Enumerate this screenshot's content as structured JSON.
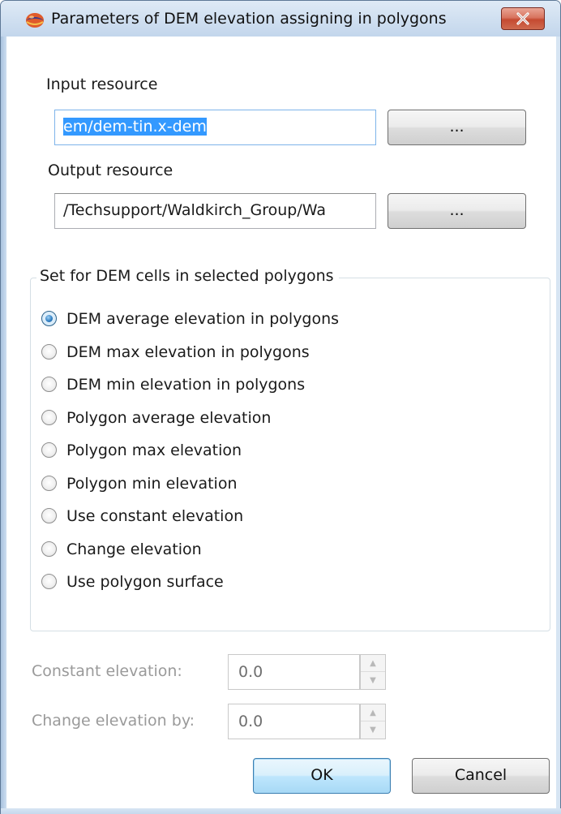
{
  "window": {
    "title": "Parameters of DEM elevation assigning in polygons",
    "icons": {
      "app": "app-globe-icon",
      "close": "close-icon"
    }
  },
  "input_resource": {
    "label": "Input resource",
    "value": "em/dem-tin.x-dem",
    "browse_label": "..."
  },
  "output_resource": {
    "label": "Output resource",
    "value": "/Techsupport/Waldkirch_Group/Wa",
    "browse_label": "..."
  },
  "mode_group": {
    "title": "Set for DEM cells in selected polygons",
    "selected_index": 0,
    "options": [
      "DEM average elevation  in polygons",
      "DEM max elevation  in polygons",
      "DEM min elevation  in polygons",
      "Polygon average elevation",
      "Polygon max elevation",
      "Polygon min elevation",
      "Use constant elevation",
      "Change elevation",
      "Use polygon surface"
    ]
  },
  "constant_elevation": {
    "label": "Constant elevation:",
    "value": "0.0",
    "enabled": false
  },
  "change_elevation": {
    "label": "Change elevation by:",
    "value": "0.0",
    "enabled": false
  },
  "buttons": {
    "ok": "OK",
    "cancel": "Cancel"
  },
  "colors": {
    "selection": "#3399ff",
    "default_button_border": "#3c7fb1",
    "close_button": "#c54a31"
  }
}
